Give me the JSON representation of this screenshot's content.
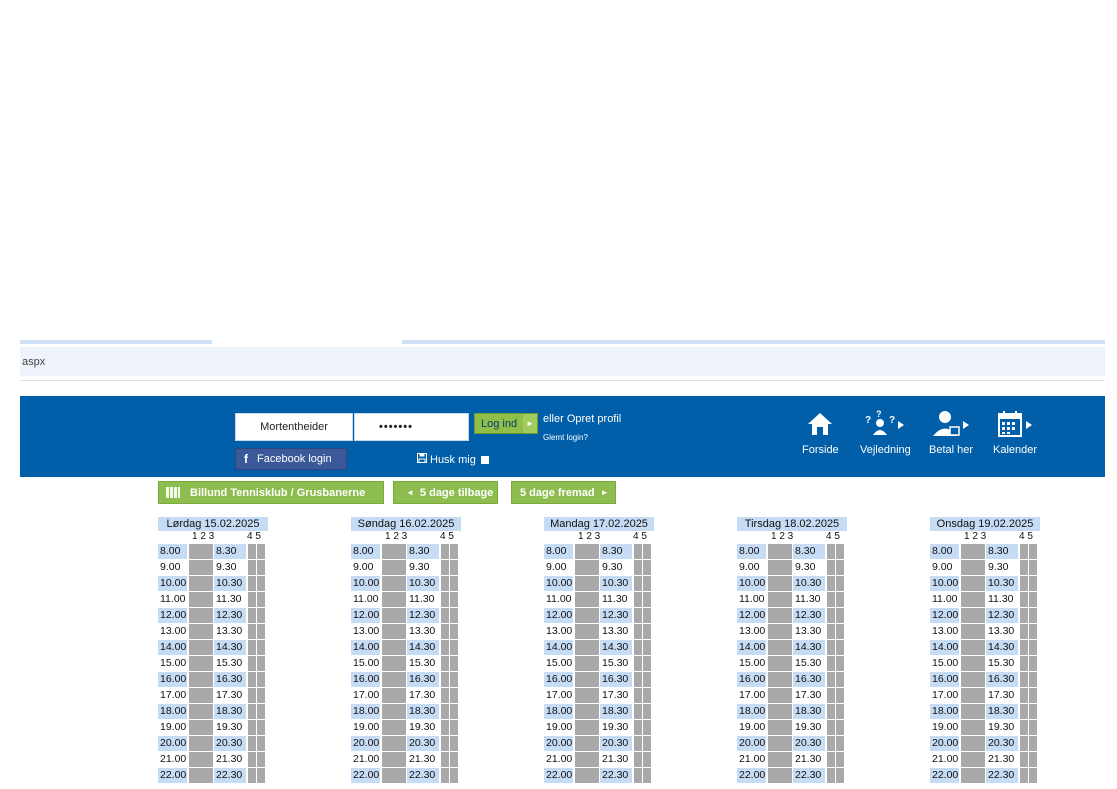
{
  "browser": {
    "address_text": "aspx"
  },
  "login": {
    "username": "Mortentheider",
    "password": "•••••••",
    "login_label": "Log ind",
    "login_arrow": "►",
    "create_profile": "eller Opret profil",
    "forgot": "Glemt login?",
    "facebook_label": "Facebook login",
    "remember_label": "Husk mig"
  },
  "nav": [
    {
      "label": "Forside",
      "icon": "home-icon"
    },
    {
      "label": "Vejledning",
      "icon": "help-person-icon"
    },
    {
      "label": "Betal her",
      "icon": "pay-person-icon"
    },
    {
      "label": "Kalender",
      "icon": "calendar-icon"
    }
  ],
  "toolbar": {
    "club_label": "Billund Tennisklub / Grusbanerne",
    "back_label": "5 dage tilbage",
    "forward_label": "5 dage fremad"
  },
  "colors": {
    "header": "#005fa8",
    "green": "#8cbd4e",
    "slot_shade": "#c6dcf5",
    "court_cell": "#a9a9a9"
  },
  "schedule": {
    "court_labels_a": "1 2 3",
    "court_labels_b": "4 5",
    "days": [
      {
        "title": "Lørdag 15.02.2025"
      },
      {
        "title": "Søndag 16.02.2025"
      },
      {
        "title": "Mandag 17.02.2025"
      },
      {
        "title": "Tirsdag 18.02.2025"
      },
      {
        "title": "Onsdag 19.02.2025"
      }
    ],
    "slots": [
      {
        "a": "8.00",
        "b": "8.30"
      },
      {
        "a": "9.00",
        "b": "9.30"
      },
      {
        "a": "10.00",
        "b": "10.30"
      },
      {
        "a": "11.00",
        "b": "11.30"
      },
      {
        "a": "12.00",
        "b": "12.30"
      },
      {
        "a": "13.00",
        "b": "13.30"
      },
      {
        "a": "14.00",
        "b": "14.30"
      },
      {
        "a": "15.00",
        "b": "15.30"
      },
      {
        "a": "16.00",
        "b": "16.30"
      },
      {
        "a": "17.00",
        "b": "17.30"
      },
      {
        "a": "18.00",
        "b": "18.30"
      },
      {
        "a": "19.00",
        "b": "19.30"
      },
      {
        "a": "20.00",
        "b": "20.30"
      },
      {
        "a": "21.00",
        "b": "21.30"
      },
      {
        "a": "22.00",
        "b": "22.30"
      }
    ]
  }
}
